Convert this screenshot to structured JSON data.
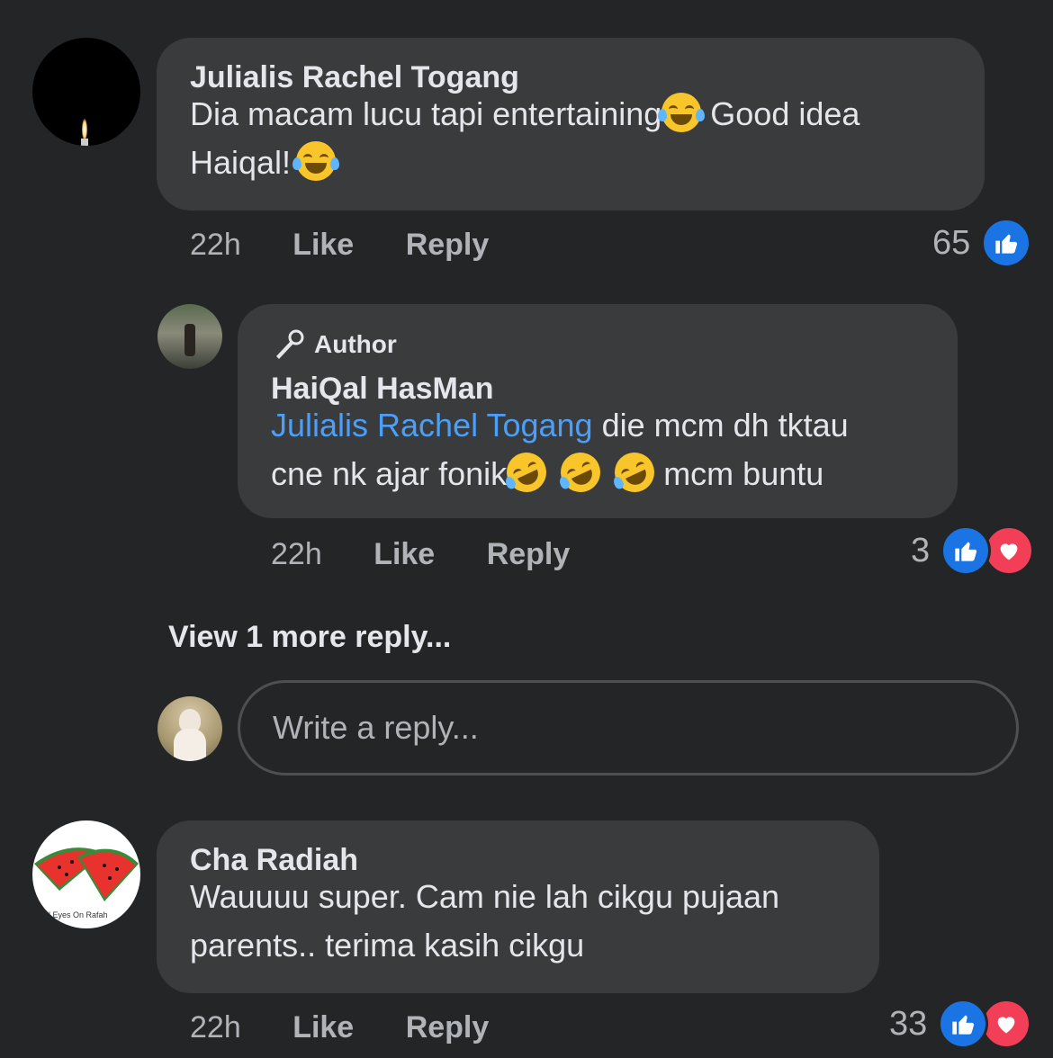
{
  "comments": [
    {
      "author": "Julialis Rachel Togang",
      "text_part1": "Dia macam lucu tapi entertaining",
      "text_part2": " Good idea",
      "text_part3": "Haiqal!",
      "emoji": "face-with-tears-of-joy",
      "time": "22h",
      "like_label": "Like",
      "reply_label": "Reply",
      "reaction_count": "65",
      "reactions": [
        "like"
      ]
    },
    {
      "badge": "Author",
      "author": "HaiQal HasMan",
      "mention": "Julialis Rachel Togang",
      "text_part1": " die mcm dh tktau",
      "text_part2": "cne nk ajar fonik",
      "text_part3": " mcm buntu",
      "emoji": "rolling-on-the-floor-laughing",
      "time": "22h",
      "like_label": "Like",
      "reply_label": "Reply",
      "reaction_count": "3",
      "reactions": [
        "like",
        "love"
      ]
    },
    {
      "author": "Cha Radiah",
      "text_line1": "Wauuuu super. Cam nie lah cikgu pujaan",
      "text_line2": "parents.. terima kasih cikgu",
      "avatar_caption": "All Eyes On Rafah",
      "time": "22h",
      "like_label": "Like",
      "reply_label": "Reply",
      "reaction_count": "33",
      "reactions": [
        "like",
        "love"
      ]
    }
  ],
  "view_more": "View 1 more reply...",
  "reply_box": {
    "placeholder": "Write a reply..."
  },
  "colors": {
    "background": "#242526",
    "bubble": "#3a3b3c",
    "mention": "#4b9ff8",
    "like": "#1b74e4",
    "love": "#f33e58"
  }
}
